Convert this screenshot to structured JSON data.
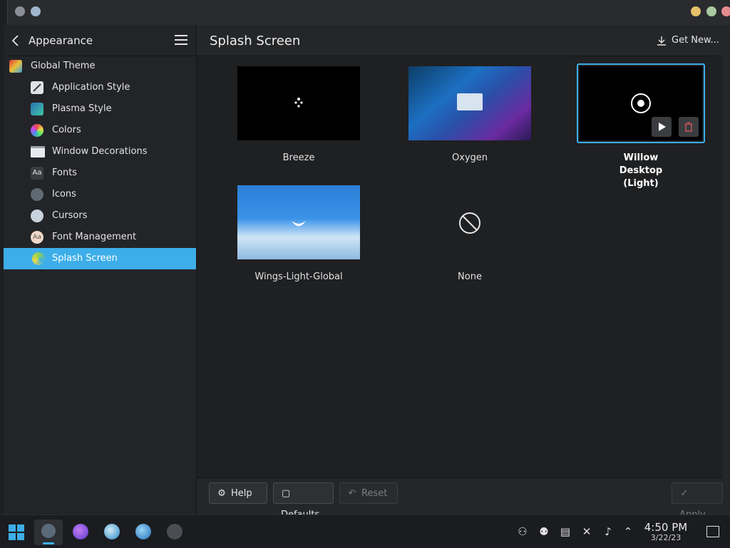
{
  "sidebar": {
    "title": "Appearance",
    "items": [
      {
        "label": "Global Theme",
        "icon": "global-theme-icon"
      },
      {
        "label": "Application Style",
        "icon": "application-style-icon"
      },
      {
        "label": "Plasma Style",
        "icon": "plasma-style-icon"
      },
      {
        "label": "Colors",
        "icon": "colors-icon"
      },
      {
        "label": "Window Decorations",
        "icon": "window-decorations-icon"
      },
      {
        "label": "Fonts",
        "icon": "fonts-icon"
      },
      {
        "label": "Icons",
        "icon": "icons-icon"
      },
      {
        "label": "Cursors",
        "icon": "cursors-icon"
      },
      {
        "label": "Font Management",
        "icon": "font-management-icon"
      },
      {
        "label": "Splash Screen",
        "icon": "splash-screen-icon"
      }
    ]
  },
  "main": {
    "title": "Splash Screen",
    "get_new": "Get New...",
    "themes": [
      {
        "label": "Breeze"
      },
      {
        "label": "Oxygen"
      },
      {
        "label": "Willow Desktop (Light)"
      },
      {
        "label": "Wings-Light-Global"
      },
      {
        "label": "None"
      }
    ]
  },
  "footer": {
    "help": "Help",
    "defaults": "Defaults",
    "reset": "Reset",
    "apply": "Apply"
  },
  "taskbar": {
    "time": "4:50 PM",
    "date": "3/22/23"
  },
  "colors": {
    "accent": "#3daee9",
    "selected_text": "#ffffff"
  }
}
